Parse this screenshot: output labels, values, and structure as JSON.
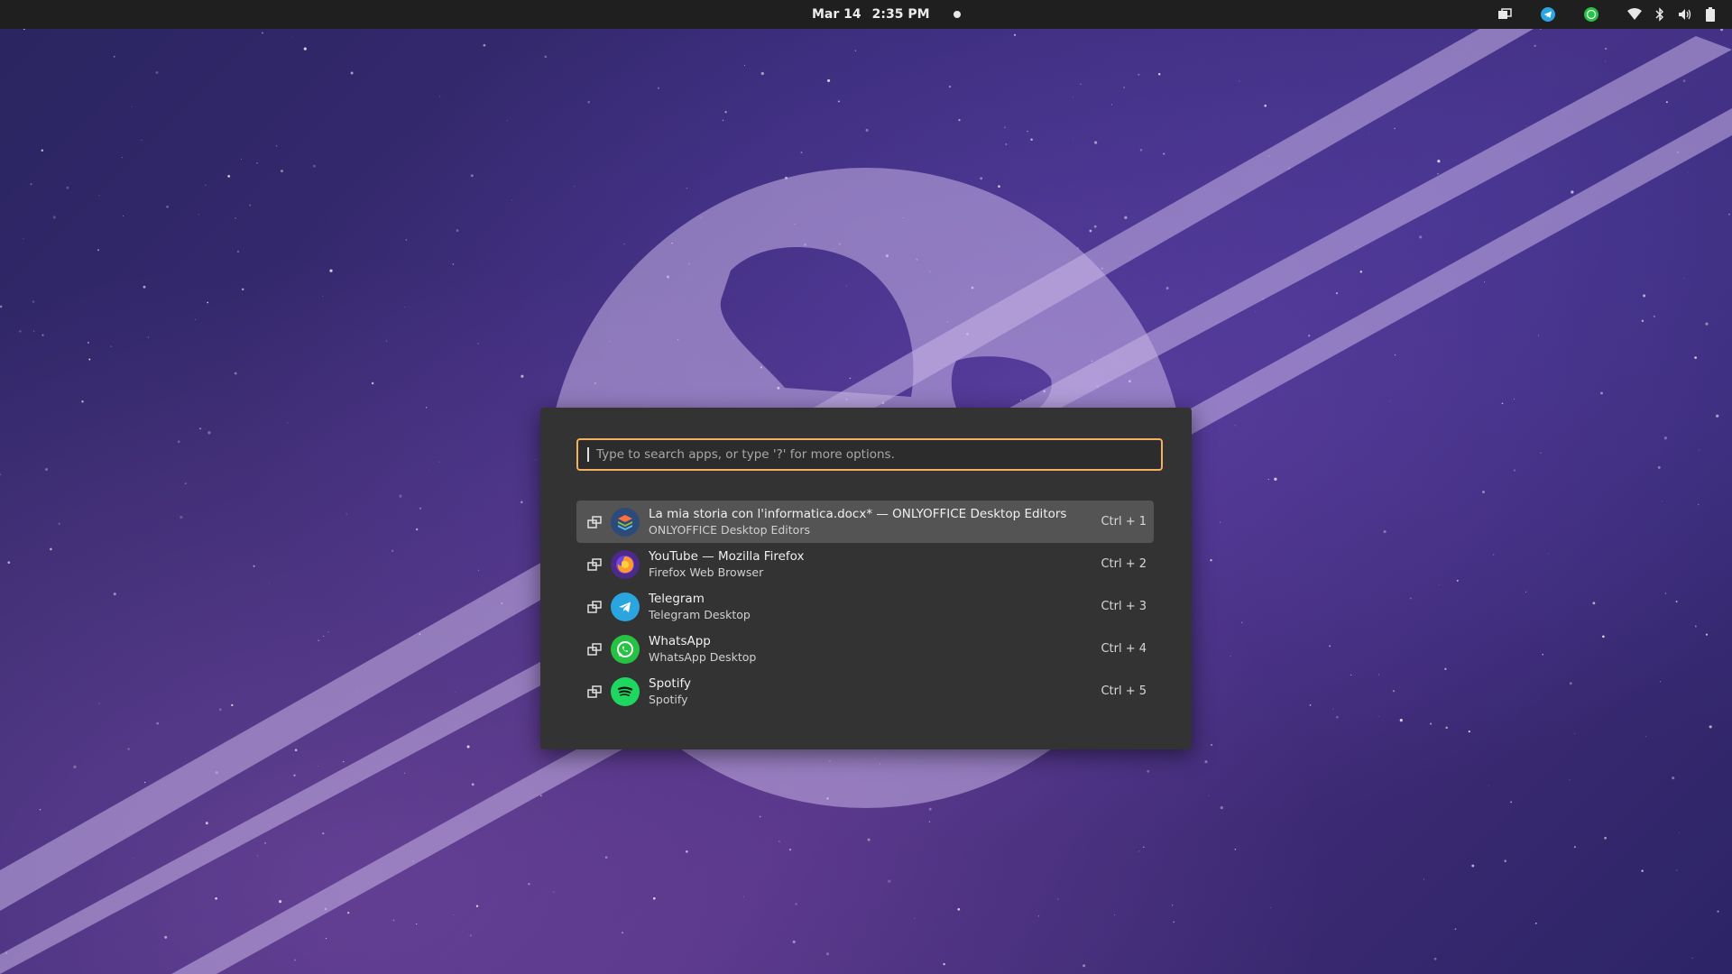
{
  "topbar": {
    "date": "Mar 14",
    "time": "2:35 PM",
    "tray_icons": [
      "workspaces-icon",
      "telegram-tray-icon",
      "whatsapp-tray-icon",
      "wifi-icon",
      "bluetooth-icon",
      "volume-icon",
      "battery-icon"
    ]
  },
  "launcher": {
    "search": {
      "value": "",
      "placeholder": "Type to search apps, or type '?' for more options."
    },
    "results": [
      {
        "title": "La mia storia con l'informatica.docx* — ONLYOFFICE Desktop Editors",
        "subtitle": "ONLYOFFICE Desktop Editors",
        "shortcut": "Ctrl + 1",
        "icon": "onlyoffice-icon",
        "selected": true
      },
      {
        "title": "YouTube — Mozilla Firefox",
        "subtitle": "Firefox Web Browser",
        "shortcut": "Ctrl + 2",
        "icon": "firefox-icon",
        "selected": false
      },
      {
        "title": "Telegram",
        "subtitle": "Telegram Desktop",
        "shortcut": "Ctrl + 3",
        "icon": "telegram-icon",
        "selected": false
      },
      {
        "title": "WhatsApp",
        "subtitle": "WhatsApp Desktop",
        "shortcut": "Ctrl + 4",
        "icon": "whatsapp-icon",
        "selected": false
      },
      {
        "title": "Spotify",
        "subtitle": "Spotify",
        "shortcut": "Ctrl + 5",
        "icon": "spotify-icon",
        "selected": false
      }
    ]
  },
  "colors": {
    "search_border": "#f5b060",
    "launcher_bg": "#333333",
    "selected_row": "#545454",
    "telegram": "#2aa5e0",
    "whatsapp": "#25c244",
    "spotify": "#1ed760"
  }
}
